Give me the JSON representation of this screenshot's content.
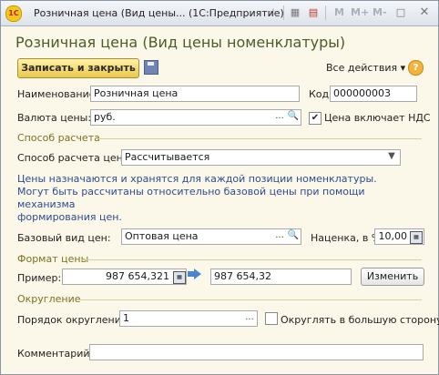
{
  "window": {
    "title": "Розничная цена (Вид цены... (1С:Предприятие)",
    "logo": "1С",
    "memory_buttons": [
      "M",
      "M+",
      "M-"
    ],
    "window_button": "□"
  },
  "form": {
    "title": "Розничная цена (Вид цены номенклатуры)",
    "save_close_label": "Записать и закрыть",
    "all_actions_label": "Все действия ▾",
    "help_label": "?"
  },
  "fields": {
    "name": {
      "label": "Наименование:",
      "value": "Розничная цена"
    },
    "code": {
      "label": "Код:",
      "value": "000000003"
    },
    "currency": {
      "label": "Валюта цены:",
      "value": "руб.",
      "btn_dots": "...",
      "btn_search": "🔍"
    },
    "vat": {
      "label": "Цена включает НДС",
      "checked": true,
      "mark": "✔"
    },
    "calc_method": {
      "label": "Способ расчета цены:",
      "value": "Рассчитывается",
      "dropdown": "▼"
    },
    "base_type": {
      "label": "Базовый вид цен:",
      "value": "Оптовая цена",
      "btn_dots": "...",
      "btn_search": "🔍"
    },
    "markup": {
      "label": "Наценка, в %:",
      "value": "10,00"
    },
    "example": {
      "label": "Пример:",
      "value": "987 654,321",
      "result": "987 654,32",
      "change_label": "Изменить"
    },
    "rounding_order": {
      "label": "Порядок округления:",
      "value": "1",
      "btn_dots": "..."
    },
    "round_up": {
      "label": "Округлять в большую сторону",
      "checked": false
    },
    "comment": {
      "label": "Комментарий:",
      "value": ""
    }
  },
  "sections": {
    "calc": "Способ расчета",
    "format": "Формат цены",
    "rounding": "Округление"
  },
  "info_lines": [
    "Цены назначаются и хранятся для каждой позиции номенклатуры.",
    "Могут быть рассчитаны относительно базовой цены при помощи механизма",
    "формирования цен."
  ],
  "icons": {
    "calc_label": "▦"
  },
  "colors": {
    "form_background": "#fbf8e9",
    "title_color": "#4c5c26",
    "section_color": "#7e7020",
    "primary_button": "#ecc84b",
    "info_text": "#2d4b8f"
  }
}
